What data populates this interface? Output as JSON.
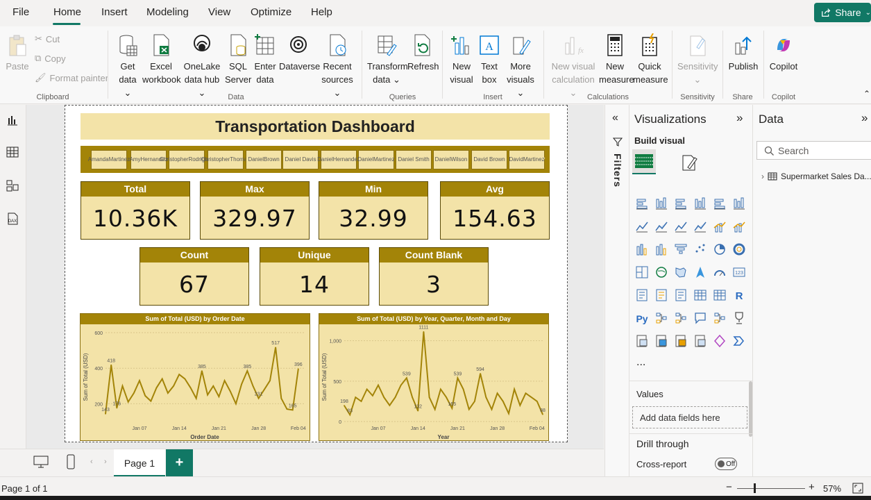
{
  "menu": {
    "items": [
      "File",
      "Home",
      "Insert",
      "Modeling",
      "View",
      "Optimize",
      "Help"
    ],
    "share": "Share"
  },
  "ribbon": {
    "clipboard": {
      "paste": "Paste",
      "cut": "Cut",
      "copy": "Copy",
      "format_painter": "Format painter",
      "group": "Clipboard"
    },
    "data": {
      "get_data": [
        "Get",
        "data ⌄"
      ],
      "excel": [
        "Excel",
        "workbook"
      ],
      "onelake": [
        "OneLake",
        "data hub ⌄"
      ],
      "sql": [
        "SQL",
        "Server"
      ],
      "enter": [
        "Enter",
        "data"
      ],
      "dataverse": [
        "Dataverse",
        ""
      ],
      "recent": [
        "Recent",
        "sources ⌄"
      ],
      "group": "Data"
    },
    "queries": {
      "transform": [
        "Transform",
        "data ⌄"
      ],
      "refresh": [
        "Refresh",
        ""
      ],
      "group": "Queries"
    },
    "insert": {
      "new_visual": [
        "New",
        "visual"
      ],
      "text_box": [
        "Text",
        "box"
      ],
      "more_visuals": [
        "More",
        "visuals ⌄"
      ],
      "group": "Insert"
    },
    "calculations": {
      "new_visual_calc": [
        "New visual",
        "calculation ⌄"
      ],
      "new_measure": [
        "New",
        "measure"
      ],
      "quick_measure": [
        "Quick",
        "measure"
      ],
      "group": "Calculations"
    },
    "sensitivity": {
      "label": [
        "Sensitivity",
        "⌄"
      ],
      "group": "Sensitivity"
    },
    "share": {
      "publish": "Publish",
      "group": "Share"
    },
    "copilot": {
      "label": "Copilot",
      "group": "Copilot"
    }
  },
  "report": {
    "title": "Transportation Dashboard",
    "slicer": [
      [
        "Amanda",
        "Martinez"
      ],
      [
        "Amy",
        "Hernandez"
      ],
      [
        "Christopher",
        "Rodriguez"
      ],
      [
        "Christopher",
        "Thomas"
      ],
      [
        "Daniel",
        "Brown"
      ],
      [
        "Daniel Davis",
        ""
      ],
      [
        "Daniel",
        "Hernandez"
      ],
      [
        "Daniel",
        "Martinez"
      ],
      [
        "Daniel Smith",
        ""
      ],
      [
        "Daniel",
        "Wilson"
      ],
      [
        "David Brown",
        ""
      ],
      [
        "David",
        "Martinez"
      ]
    ],
    "cards": [
      {
        "label": "Total",
        "value": "10.36K"
      },
      {
        "label": "Max",
        "value": "329.97"
      },
      {
        "label": "Min",
        "value": "32.99"
      },
      {
        "label": "Avg",
        "value": "154.63"
      },
      {
        "label": "Count",
        "value": "67"
      },
      {
        "label": "Unique",
        "value": "14"
      },
      {
        "label": "Count Blank",
        "value": "3"
      }
    ]
  },
  "chart_data": [
    {
      "type": "line",
      "title": "Sum of Total (USD) by Order Date",
      "xlabel": "Order Date",
      "ylabel": "Sum of Total (USD)",
      "ylim": [
        100,
        600
      ],
      "yticks": [
        "600",
        "400",
        "200"
      ],
      "xticks": [
        "Jan 07",
        "Jan 14",
        "Jan 21",
        "Jan 28",
        "Feb 04"
      ],
      "color": "#a38408",
      "x": [
        "Jan 01",
        "Jan 02",
        "Jan 03",
        "Jan 04",
        "Jan 05",
        "Jan 06",
        "Jan 07",
        "Jan 08",
        "Jan 09",
        "Jan 10",
        "Jan 11",
        "Jan 12",
        "Jan 13",
        "Jan 14",
        "Jan 15",
        "Jan 16",
        "Jan 17",
        "Jan 18",
        "Jan 19",
        "Jan 20",
        "Jan 21",
        "Jan 22",
        "Jan 23",
        "Jan 24",
        "Jan 25",
        "Jan 26",
        "Jan 27",
        "Jan 28",
        "Jan 29",
        "Jan 30",
        "Jan 31",
        "Feb 01",
        "Feb 02",
        "Feb 03",
        "Feb 04",
        "Feb 05"
      ],
      "values": [
        143,
        418,
        176,
        300,
        210,
        260,
        330,
        245,
        215,
        290,
        340,
        260,
        300,
        365,
        340,
        290,
        230,
        385,
        250,
        300,
        240,
        330,
        270,
        200,
        310,
        385,
        300,
        231,
        280,
        330,
        517,
        230,
        170,
        165,
        396,
        null
      ],
      "data_labels": [
        "143",
        "418",
        "176",
        "385",
        "385",
        "231",
        "517",
        "165",
        "396"
      ]
    },
    {
      "type": "line",
      "title": "Sum of Total (USD) by Year, Quarter, Month and Day",
      "xlabel": "Year",
      "ylabel": "Sum of Total (USD)",
      "ylim": [
        0,
        1100
      ],
      "yticks": [
        "1,000",
        "500",
        "0"
      ],
      "xticks": [
        "Jan 07",
        "Jan 14",
        "Jan 21",
        "Jan 28",
        "Feb 04"
      ],
      "color": "#a38408",
      "x": [
        "Jan 01",
        "Jan 02",
        "Jan 03",
        "Jan 04",
        "Jan 05",
        "Jan 06",
        "Jan 07",
        "Jan 08",
        "Jan 09",
        "Jan 10",
        "Jan 11",
        "Jan 12",
        "Jan 13",
        "Jan 14",
        "Jan 15",
        "Jan 16",
        "Jan 17",
        "Jan 18",
        "Jan 19",
        "Jan 20",
        "Jan 21",
        "Jan 22",
        "Jan 23",
        "Jan 24",
        "Jan 25",
        "Jan 26",
        "Jan 27",
        "Jan 28",
        "Jan 29",
        "Jan 30",
        "Jan 31",
        "Feb 01",
        "Feb 02",
        "Feb 03",
        "Feb 04",
        "Feb 05"
      ],
      "values": [
        198,
        83,
        300,
        250,
        400,
        320,
        450,
        300,
        200,
        300,
        450,
        539,
        300,
        132,
        1111,
        300,
        150,
        400,
        300,
        165,
        539,
        400,
        150,
        250,
        594,
        300,
        150,
        350,
        250,
        100,
        400,
        200,
        350,
        300,
        250,
        88
      ],
      "data_labels": [
        "198",
        "83",
        "539",
        "132",
        "1111",
        "165",
        "539",
        "594",
        "88"
      ]
    }
  ],
  "filters": {
    "label": "Filters"
  },
  "visualizations": {
    "title": "Visualizations",
    "build_visual": "Build visual",
    "more": "...",
    "values_label": "Values",
    "add_fields": "Add data fields here",
    "drill_through": "Drill through",
    "cross_report": "Cross-report",
    "toggle": "Off"
  },
  "data_pane": {
    "title": "Data",
    "search_placeholder": "Search",
    "table": "Supermarket Sales Da..."
  },
  "pages": {
    "tab": "Page 1",
    "add": "+"
  },
  "status": {
    "page_info": "Page 1 of 1",
    "zoom": "57%",
    "minus": "−",
    "plus": "+"
  },
  "colors": {
    "accent": "#117865",
    "gold": "#a38408",
    "cream": "#f3e3a8"
  }
}
